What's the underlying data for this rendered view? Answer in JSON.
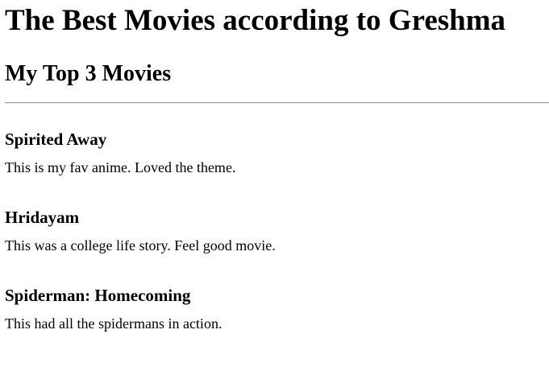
{
  "header": {
    "title": "The Best Movies according to Greshma",
    "subtitle": "My Top 3 Movies"
  },
  "movies": [
    {
      "name": "Spirited Away",
      "description": "This is my fav anime. Loved the theme."
    },
    {
      "name": "Hridayam",
      "description": "This was a college life story. Feel good movie."
    },
    {
      "name": "Spiderman: Homecoming",
      "description": "This had all the spidermans in action."
    }
  ]
}
